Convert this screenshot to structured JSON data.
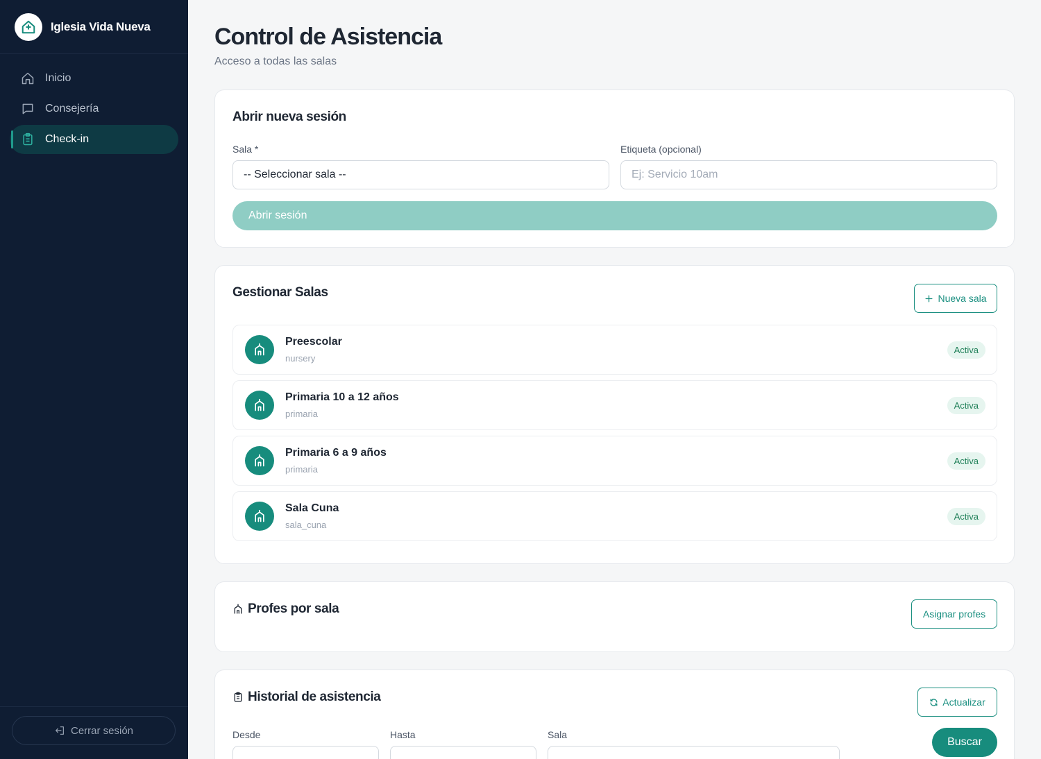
{
  "brand": {
    "name": "Iglesia Vida Nueva",
    "logo_icon": "church-home-icon"
  },
  "nav": {
    "items": [
      {
        "label": "Inicio",
        "icon": "home-icon",
        "active": false
      },
      {
        "label": "Consejería",
        "icon": "chat-icon",
        "active": false
      },
      {
        "label": "Check-in",
        "icon": "clipboard-icon",
        "active": true
      }
    ]
  },
  "sidebar_footer": {
    "logout_label": "Cerrar sesión",
    "logout_icon": "logout-icon"
  },
  "header": {
    "title": "Control de Asistencia",
    "subtitle": "Acceso a todas las salas"
  },
  "open_session": {
    "title": "Abrir nueva sesión",
    "sala_label": "Sala *",
    "sala_value": "-- Seleccionar sala --",
    "tag_label": "Etiqueta (opcional)",
    "tag_placeholder": "Ej: Servicio 10am",
    "submit_label": "Abrir sesión"
  },
  "manage_rooms": {
    "title": "Gestionar Salas",
    "new_room_label": "Nueva sala",
    "rooms": [
      {
        "name": "Preescolar",
        "code": "nursery",
        "status": "Activa"
      },
      {
        "name": "Primaria 10 a 12 años",
        "code": "primaria",
        "status": "Activa"
      },
      {
        "name": "Primaria 6 a 9 años",
        "code": "primaria",
        "status": "Activa"
      },
      {
        "name": "Sala Cuna",
        "code": "sala_cuna",
        "status": "Activa"
      }
    ]
  },
  "teachers": {
    "title": "Profes por sala",
    "assign_label": "Asignar profes"
  },
  "history": {
    "title": "Historial de asistencia",
    "refresh_label": "Actualizar",
    "desde_label": "Desde",
    "hasta_label": "Hasta",
    "sala_label": "Sala",
    "search_label": "Buscar"
  },
  "colors": {
    "sidebar_bg": "#0f1d33",
    "accent": "#178c7d",
    "accent_light": "#8fcdc4",
    "badge_bg": "#e6f5ef",
    "badge_text": "#1e7f57"
  }
}
